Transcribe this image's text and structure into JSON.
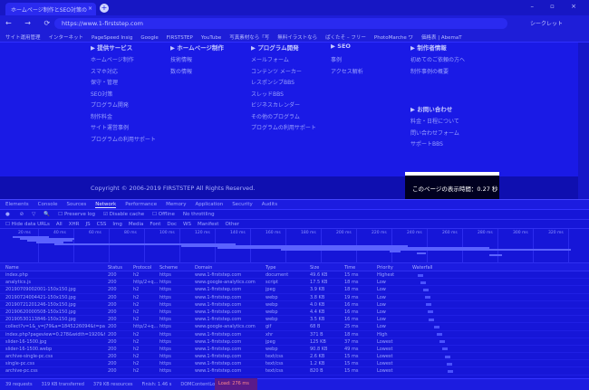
{
  "browser": {
    "tab_title": "ホームページ制作とSEO対策の",
    "tab_close": "×",
    "new_tab": "+",
    "window_controls": "– ▫ ×",
    "nav_icons": "← → ⟳ ⌂",
    "url": "https://www.1-firststep.com",
    "profile": "シークレット",
    "bookmarks": [
      "サイト運用管理",
      "インターネット",
      "PageSpeed Insig",
      "Google",
      "FIRSTSTEP",
      "YouTube",
      "写真素材なら「写",
      "無料イラストなら",
      "ぱくたそ – フリー",
      "PhotoMarche ワ",
      "価格表 | AbemaT"
    ]
  },
  "site": {
    "columns": [
      {
        "head": "▶ 提供サービス",
        "items": [
          "ホームページ制作",
          "スマホ対応",
          "保守・管理",
          "SEO対策",
          "プログラム開発",
          "制作料金",
          "サイト運営事例",
          "プログラムの利用サポート"
        ]
      },
      {
        "head": "▶ ホームページ制作",
        "items": [
          "技術情報",
          "数の情報"
        ]
      },
      {
        "head": "▶ プログラム開発",
        "items": [
          "メールフォーム",
          "コンテンツ メーカー",
          "レスポンシブBBS",
          "スレッドBBS",
          "ビジネスカレンダー",
          "その他のプログラム",
          "プログラムの利用サポート"
        ]
      },
      {
        "head": "▶ SEO",
        "items": [
          "事例",
          "アクセス解析"
        ]
      },
      {
        "head": "▶ 制作者情報",
        "items": [
          "初めてのご依頼の方へ",
          "制作事例の概要"
        ]
      }
    ],
    "contact": {
      "head": "▶ お問い合わせ",
      "items": [
        "料金・日程について",
        "問い合わせフォーム",
        "サポートBBS"
      ]
    },
    "copyright": "Copyright © 2006-2019 FIRSTSTEP All Rights Reserved.",
    "load_time": "このページの表示時間：0.27 秒"
  },
  "devtools": {
    "tabs": [
      "Elements",
      "Console",
      "Sources",
      "Network",
      "Performance",
      "Memory",
      "Application",
      "Security",
      "Audits"
    ],
    "active_tab": "Network",
    "toolbar": [
      "● ",
      "⊘",
      "▽",
      "🔍",
      "☐ Preserve log",
      "☑ Disable cache",
      "☐ Offline",
      "No throttling"
    ],
    "filter": [
      "☐ Hide data URLs",
      "All",
      "XHR",
      "JS",
      "CSS",
      "Img",
      "Media",
      "Font",
      "Doc",
      "WS",
      "Manifest",
      "Other"
    ],
    "timeline_ticks": [
      "20 ms",
      "40 ms",
      "60 ms",
      "80 ms",
      "100 ms",
      "120 ms",
      "140 ms",
      "160 ms",
      "180 ms",
      "200 ms",
      "220 ms",
      "240 ms",
      "260 ms",
      "280 ms",
      "300 ms",
      "320 ms"
    ],
    "columns": [
      "Name",
      "Status",
      "Protocol",
      "Scheme",
      "Domain",
      "Type",
      "Size",
      "Time",
      "Priority",
      "Waterfall"
    ],
    "requests": [
      {
        "name": "index.php",
        "status": "200",
        "protocol": "h2",
        "scheme": "https",
        "domain": "www.1-firststep.com",
        "type": "document",
        "size": "49.6 KB",
        "time": "15 ms",
        "priority": "Highest",
        "wf": 0.04
      },
      {
        "name": "analytics.js",
        "status": "200",
        "protocol": "http/2+q...",
        "scheme": "https",
        "domain": "www.google-analytics.com",
        "type": "script",
        "size": "17.5 KB",
        "time": "18 ms",
        "priority": "Low",
        "wf": 0.06
      },
      {
        "name": "20190709002001-150x150.jpg",
        "status": "200",
        "protocol": "h2",
        "scheme": "https",
        "domain": "www.1-firststep.com",
        "type": "jpeg",
        "size": "3.9 KB",
        "time": "18 ms",
        "priority": "Low",
        "wf": 0.08
      },
      {
        "name": "20190724004421-150x150.jpg",
        "status": "200",
        "protocol": "h2",
        "scheme": "https",
        "domain": "www.1-firststep.com",
        "type": "webp",
        "size": "3.8 KB",
        "time": "19 ms",
        "priority": "Low",
        "wf": 0.09
      },
      {
        "name": "20190721201246-150x150.jpg",
        "status": "200",
        "protocol": "h2",
        "scheme": "https",
        "domain": "www.1-firststep.com",
        "type": "webp",
        "size": "4.0 KB",
        "time": "16 ms",
        "priority": "Low",
        "wf": 0.1
      },
      {
        "name": "20190620000508-150x150.jpg",
        "status": "200",
        "protocol": "h2",
        "scheme": "https",
        "domain": "www.1-firststep.com",
        "type": "webp",
        "size": "4.4 KB",
        "time": "16 ms",
        "priority": "Low",
        "wf": 0.11
      },
      {
        "name": "20190530113846-150x150.jpg",
        "status": "200",
        "protocol": "h2",
        "scheme": "https",
        "domain": "www.1-firststep.com",
        "type": "webp",
        "size": "3.5 KB",
        "time": "16 ms",
        "priority": "Low",
        "wf": 0.12
      },
      {
        "name": "collect?v=1&_v=j79&a=1845226094&t=pagev...",
        "status": "200",
        "protocol": "http/2+q...",
        "scheme": "https",
        "domain": "www.google-analytics.com",
        "type": "gif",
        "size": "68 B",
        "time": "25 ms",
        "priority": "Low",
        "wf": 0.16
      },
      {
        "name": "index.php?pageview=0.278&width=1920&he...",
        "status": "200",
        "protocol": "h2",
        "scheme": "https",
        "domain": "www.1-firststep.com",
        "type": "xhr",
        "size": "371 B",
        "time": "18 ms",
        "priority": "High",
        "wf": 0.18
      },
      {
        "name": "slider-16-1500.jpg",
        "status": "200",
        "protocol": "h2",
        "scheme": "https",
        "domain": "www.1-firststep.com",
        "type": "jpeg",
        "size": "125 KB",
        "time": "37 ms",
        "priority": "Lowest",
        "wf": 0.2
      },
      {
        "name": "slider-16-1500.webp",
        "status": "200",
        "protocol": "h2",
        "scheme": "https",
        "domain": "www.1-firststep.com",
        "type": "webp",
        "size": "90.8 KB",
        "time": "49 ms",
        "priority": "Lowest",
        "wf": 0.22
      },
      {
        "name": "archive-single-pc.css",
        "status": "200",
        "protocol": "h2",
        "scheme": "https",
        "domain": "www.1-firststep.com",
        "type": "text/css",
        "size": "2.6 KB",
        "time": "15 ms",
        "priority": "Lowest",
        "wf": 0.24
      },
      {
        "name": "single-pc.css",
        "status": "200",
        "protocol": "h2",
        "scheme": "https",
        "domain": "www.1-firststep.com",
        "type": "text/css",
        "size": "1.2 KB",
        "time": "15 ms",
        "priority": "Lowest",
        "wf": 0.25
      },
      {
        "name": "archive-pc.css",
        "status": "200",
        "protocol": "h2",
        "scheme": "https",
        "domain": "www.1-firststep.com",
        "type": "text/css",
        "size": "820 B",
        "time": "15 ms",
        "priority": "Lowest",
        "wf": 0.26
      }
    ],
    "status": [
      "39 requests",
      "319 KB transferred",
      "379 KB resources",
      "Finish: 1.46 s",
      "DOMContentLoaded: 228 ms"
    ],
    "load": "Load: 276 ms"
  }
}
